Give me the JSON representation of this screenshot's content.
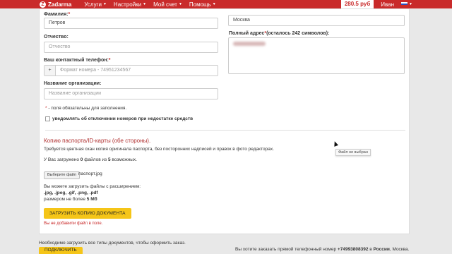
{
  "nav": {
    "logo_text": "Zadarma",
    "menu": [
      {
        "label": "Услуги"
      },
      {
        "label": "Настройки"
      },
      {
        "label": "Мой счет"
      },
      {
        "label": "Помощь"
      }
    ],
    "balance": "280.5 руб",
    "user": "Иван",
    "brand_color": "#c92a2a"
  },
  "form": {
    "surname_label": "Фамилия:",
    "surname_value": "Петров",
    "patronymic_label": "Отчество:",
    "patronymic_placeholder": "Отчество",
    "phone_label": "Ваш контактный телефон:",
    "phone_prefix": "+",
    "phone_placeholder": "Формат номера - 74951234567",
    "org_label": "Название организации:",
    "org_placeholder": "Название организации",
    "city_value": "Москва",
    "address_label": "Полный адрес",
    "address_counter": "(осталось 242 символов):",
    "required_note": "- поля обязательны для заполнения.",
    "notify_label": "уведомлять об отключении номеров при недостатке средств"
  },
  "passport": {
    "title": "Копию паспорта/ID-карты (обе стороны).",
    "requirement": "Требуется цветная скан копия оригинала паспорта, без посторонних надписей и правок в фото редакторах.",
    "uploaded_prefix": "У Вас загружено",
    "uploaded_count": "0",
    "uploaded_mid": "файлов из",
    "uploaded_total": "5",
    "uploaded_suffix": "возможных.",
    "choose_file_label": "Выберите файл",
    "file_name": "паспорт.jpg",
    "formats_intro": "Вы можете загрузить файлы с расширением:",
    "formats": ".jpg, .jpeg, .gif, .png, .pdf",
    "size_prefix": "размером не более",
    "size_value": "5 Мб",
    "upload_button": "ЗАГРУЗИТЬ КОПИЮ ДОКУМЕНТА",
    "error": "Вы не добавили файл в поле."
  },
  "tooltip": "Файл не выбран",
  "footer": {
    "left": "Необходимо загрузить все типы документов, чтобы оформить заказ.",
    "right_prefix": "Вы хотите заказать прямой телефонный номер",
    "right_number": "+74993808392",
    "right_mid": "в",
    "right_country": "России",
    "right_city": ", Москва.",
    "partial_button": "ПОДКЛЮЧИТЬ"
  }
}
